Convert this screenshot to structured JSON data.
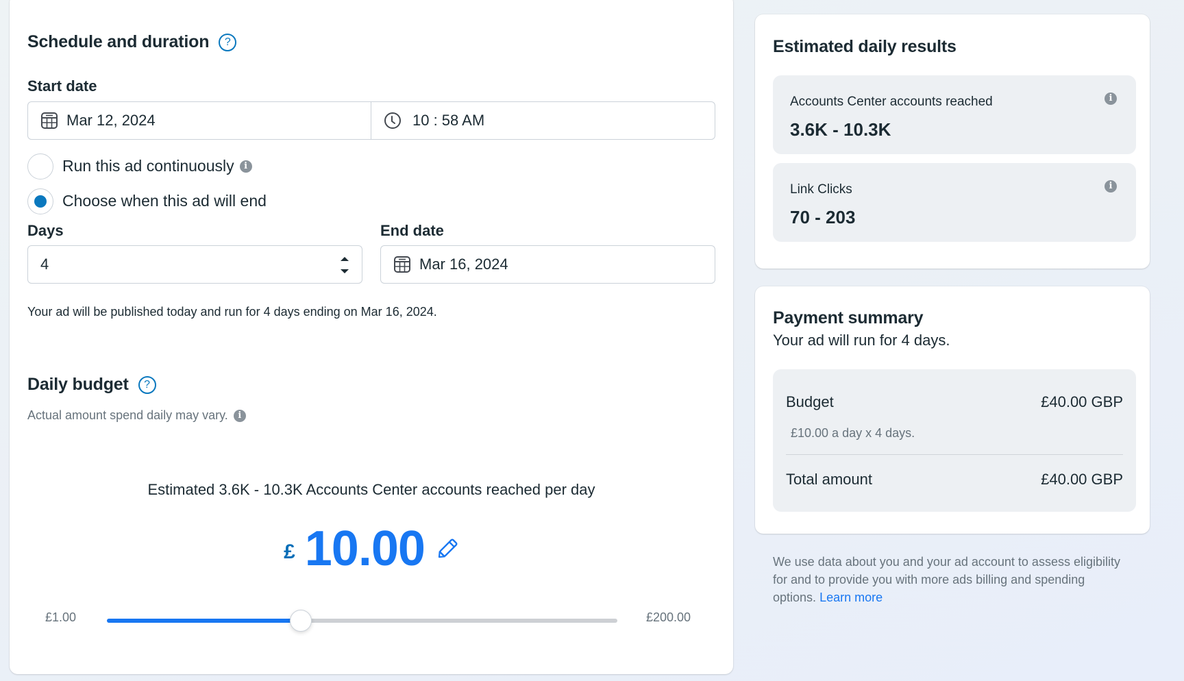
{
  "schedule": {
    "title": "Schedule and duration",
    "start_date_label": "Start date",
    "start_date_value": "Mar 12, 2024",
    "start_time_value": "10 : 58 AM",
    "options": [
      {
        "label": "Run this ad continuously",
        "checked": false,
        "has_info": true
      },
      {
        "label": "Choose when this ad will end",
        "checked": true,
        "has_info": false
      }
    ],
    "days_label": "Days",
    "days_value": "4",
    "end_date_label": "End date",
    "end_date_value": "Mar 16, 2024",
    "summary_text": "Your ad will be published today and run for 4 days ending on Mar 16, 2024."
  },
  "budget": {
    "title": "Daily budget",
    "subtitle": "Actual amount spend daily may vary.",
    "estimate_text": "Estimated 3.6K - 10.3K Accounts Center accounts reached per day",
    "currency_symbol": "£",
    "amount": "10.00",
    "slider": {
      "min_label": "£1.00",
      "max_label": "£200.00",
      "fill_fraction": 0.38
    }
  },
  "estimated_results": {
    "title": "Estimated daily results",
    "metrics": [
      {
        "label": "Accounts Center accounts reached",
        "value": "3.6K - 10.3K"
      },
      {
        "label": "Link Clicks",
        "value": "70 - 203"
      }
    ]
  },
  "payment_summary": {
    "title": "Payment summary",
    "subtitle": "Your ad will run for 4 days.",
    "budget_label": "Budget",
    "budget_value": "£40.00 GBP",
    "budget_detail": "£10.00 a day x 4 days.",
    "total_label": "Total amount",
    "total_value": "£40.00 GBP"
  },
  "footer": {
    "text": "We use data about you and your ad account to assess eligibility for and to provide you with more ads billing and spending options.",
    "link_label": "Learn more"
  },
  "icons": {
    "help": "?",
    "info": "i"
  },
  "colors": {
    "accent": "#1877f2",
    "radio_checked": "#0a78be"
  }
}
